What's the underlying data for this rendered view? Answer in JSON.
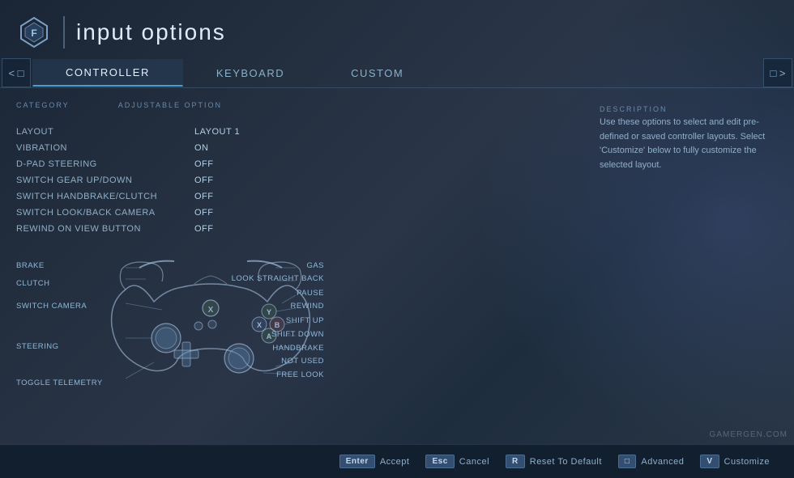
{
  "header": {
    "title": "input options"
  },
  "tabs": [
    {
      "id": "controller",
      "label": "CONTROLLER",
      "active": true
    },
    {
      "id": "keyboard",
      "label": "KEYBOARD",
      "active": false
    },
    {
      "id": "custom",
      "label": "CUSTOM",
      "active": false
    }
  ],
  "left_panel": {
    "category_label": "CATEGORY",
    "adjustable_label": "ADJUSTABLE OPTION",
    "options": [
      {
        "name": "LAYOUT",
        "value": "LAYOUT 1"
      },
      {
        "name": "VIBRATION",
        "value": "ON"
      },
      {
        "name": "D-PAD STEERING",
        "value": "OFF"
      },
      {
        "name": "SWITCH GEAR UP/DOWN",
        "value": "OFF"
      },
      {
        "name": "SWITCH HANDBRAKE/CLUTCH",
        "value": "OFF"
      },
      {
        "name": "SWITCH LOOK/BACK CAMERA",
        "value": "OFF"
      },
      {
        "name": "REWIND ON VIEW BUTTON",
        "value": "OFF"
      }
    ]
  },
  "right_panel": {
    "description_label": "DESCRIPTION",
    "description": "Use these options to select and edit pre-defined or saved controller layouts. Select 'Customize' below to fully customize the selected layout."
  },
  "controller_labels": {
    "left": [
      {
        "id": "brake",
        "text": "BRAKE"
      },
      {
        "id": "clutch",
        "text": "CLUTCH"
      },
      {
        "id": "switch_camera",
        "text": "SWITCH CAMERA"
      },
      {
        "id": "steering",
        "text": "STEERING"
      },
      {
        "id": "toggle_telemetry",
        "text": "TOGGLE TELEMETRY"
      }
    ],
    "right": [
      {
        "id": "gas",
        "text": "GAS"
      },
      {
        "id": "look_straight",
        "text": "LOOK STRAIGHT BACK"
      },
      {
        "id": "pause",
        "text": "PAUSE"
      },
      {
        "id": "rewind",
        "text": "REWIND"
      },
      {
        "id": "shift_up",
        "text": "SHIFT UP"
      },
      {
        "id": "shift_down",
        "text": "SHIFT DOWN"
      },
      {
        "id": "handbrake",
        "text": "HANDBRAKE"
      },
      {
        "id": "not_used",
        "text": "NOT USED"
      },
      {
        "id": "free_look",
        "text": "FREE LOOK"
      }
    ]
  },
  "footer": {
    "actions": [
      {
        "key": "Enter",
        "label": "Accept"
      },
      {
        "key": "Esc",
        "label": "Cancel"
      },
      {
        "key": "R",
        "label": "Reset To Default"
      },
      {
        "key": "▢",
        "label": "Advanced"
      },
      {
        "key": "V",
        "label": "Customize"
      }
    ]
  },
  "colors": {
    "accent": "#4a9fd0",
    "text_primary": "#c8d8e8",
    "text_dim": "#6a8aaa",
    "controller_stroke": "rgba(180,210,240,0.6)",
    "active_tab_underline": "#4a9fd0"
  }
}
